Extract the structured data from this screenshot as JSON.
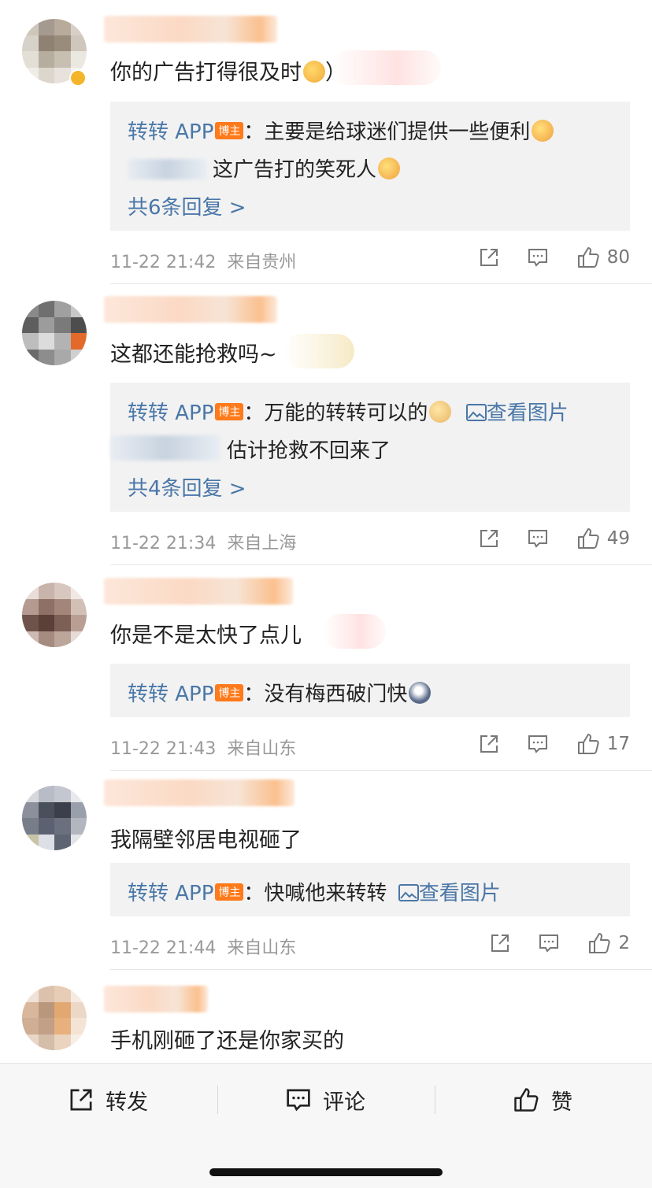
{
  "comments": [
    {
      "text": "你的广告打得很及时",
      "text_suffix": "）",
      "reply": {
        "author": "转转 APP",
        "tag": "博主",
        "line1": "：主要是给球迷们提供一些便利",
        "line2": "这广告打的笑死人",
        "more": "共6条回复 >"
      },
      "date": "11-22 21:42",
      "location": "来自贵州",
      "likes": "80"
    },
    {
      "text": "这都还能抢救吗~",
      "reply": {
        "author": "转转 APP",
        "tag": "博主",
        "line1": "：万能的转转可以的",
        "link": "查看图片",
        "line2": "估计抢救不回来了",
        "more": "共4条回复 >"
      },
      "date": "11-22 21:34",
      "location": "来自上海",
      "likes": "49"
    },
    {
      "text": "你是不是太快了点儿",
      "reply": {
        "author": "转转 APP",
        "tag": "博主",
        "line1": "：没有梅西破门快"
      },
      "date": "11-22 21:43",
      "location": "来自山东",
      "likes": "17"
    },
    {
      "text": "我隔壁邻居电视砸了",
      "reply": {
        "author": "转转 APP",
        "tag": "博主",
        "line1": "：快喊他来转转",
        "link": "查看图片"
      },
      "date": "11-22 21:44",
      "location": "来自山东",
      "likes": "2"
    },
    {
      "text": "手机刚砸了还是你家买的"
    }
  ],
  "bottom_bar": {
    "repost_label": "转发",
    "comment_label": "评论",
    "like_label": "赞"
  },
  "icons": {
    "share": "share-icon",
    "comment": "comment-icon",
    "like": "thumbs-up-icon",
    "image": "image-icon"
  },
  "colors": {
    "link": "#4a77a8",
    "tag": "#ff7a1a",
    "reply_bg": "#f2f2f2",
    "meta": "#999999"
  }
}
